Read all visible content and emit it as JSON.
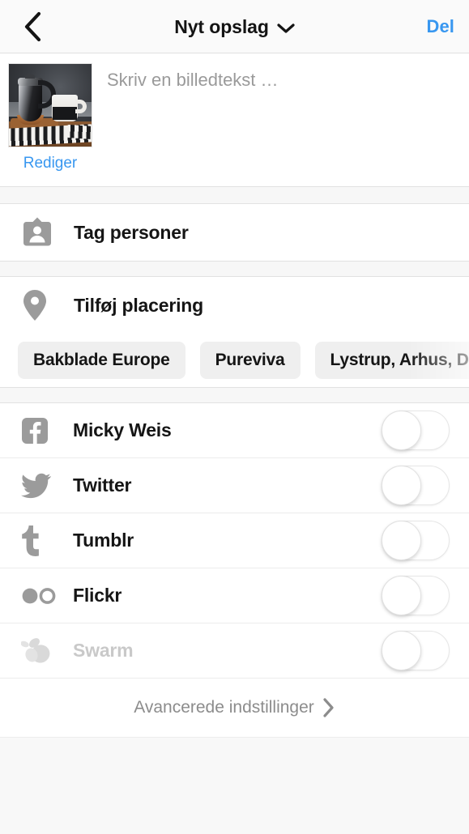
{
  "header": {
    "back_icon": "chevron-left-icon",
    "title": "Nyt opslag",
    "title_caret_icon": "chevron-down-icon",
    "share_label": "Del"
  },
  "caption": {
    "placeholder": "Skriv en billedtekst …",
    "edit_label": "Rediger",
    "thumbnail_alt": "coffee-moka-pot-photo"
  },
  "tag_people": {
    "icon": "person-badge-icon",
    "label": "Tag personer"
  },
  "location": {
    "icon": "map-pin-icon",
    "label": "Tilføj placering",
    "suggestions": [
      {
        "label": "Bakblade Europe"
      },
      {
        "label": "Pureviva"
      },
      {
        "label": "Lystrup, Arhus, De"
      }
    ]
  },
  "social": {
    "accounts": [
      {
        "icon": "facebook-icon",
        "label": "Micky Weis",
        "enabled": true,
        "toggle_on": false
      },
      {
        "icon": "twitter-icon",
        "label": "Twitter",
        "enabled": true,
        "toggle_on": false
      },
      {
        "icon": "tumblr-icon",
        "label": "Tumblr",
        "enabled": true,
        "toggle_on": false
      },
      {
        "icon": "flickr-icon",
        "label": "Flickr",
        "enabled": true,
        "toggle_on": false
      },
      {
        "icon": "swarm-icon",
        "label": "Swarm",
        "enabled": false,
        "toggle_on": false
      }
    ]
  },
  "advanced": {
    "label": "Avancerede indstillinger",
    "chevron_icon": "chevron-right-icon"
  },
  "colors": {
    "accent_blue": "#3897f0",
    "text_primary": "#151515",
    "text_muted": "#9a9a9a",
    "icon_gray": "#9b9b9b",
    "disabled_gray": "#d6d6d6",
    "chip_bg": "#efefef",
    "page_bg": "#f8f8f8"
  }
}
